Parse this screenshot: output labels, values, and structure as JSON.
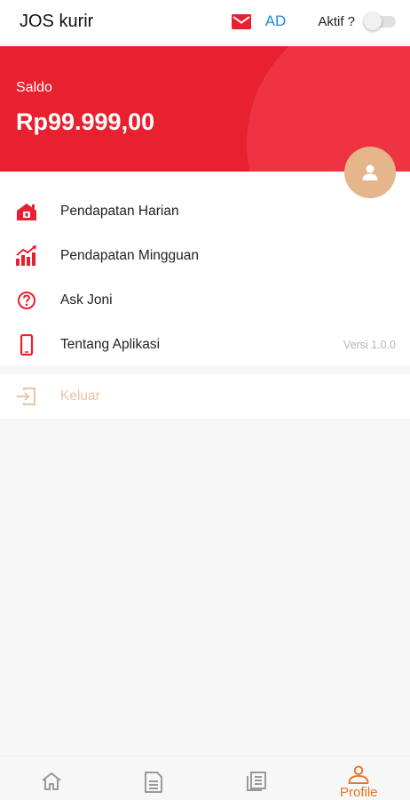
{
  "app_bar": {
    "title": "JOS kurir",
    "ad_label": "AD",
    "aktif_label": "Aktif ?",
    "aktif_on": false
  },
  "balance": {
    "label": "Saldo",
    "value": "Rp99.999,00"
  },
  "menu": {
    "items": [
      {
        "label": "Pendapatan Harian",
        "icon": "daily-income-icon"
      },
      {
        "label": "Pendapatan Mingguan",
        "icon": "weekly-income-chart-icon"
      },
      {
        "label": "Ask Joni",
        "icon": "help-circle-icon"
      },
      {
        "label": "Tentang Aplikasi",
        "icon": "phone-icon",
        "version": "Versi 1.0.0"
      }
    ],
    "logout_label": "Keluar"
  },
  "bottom_nav": {
    "items": [
      {
        "icon": "home-icon",
        "label": ""
      },
      {
        "icon": "document-icon",
        "label": ""
      },
      {
        "icon": "news-icon",
        "label": ""
      },
      {
        "icon": "profile-icon",
        "label": "Profile",
        "active": true
      }
    ]
  },
  "colors": {
    "brand_red": "#e8202f",
    "avatar_bg": "#e5b58c",
    "accent_orange": "#e87422",
    "logout_tint": "#e8c4a4",
    "ad_blue": "#1e88e5"
  }
}
